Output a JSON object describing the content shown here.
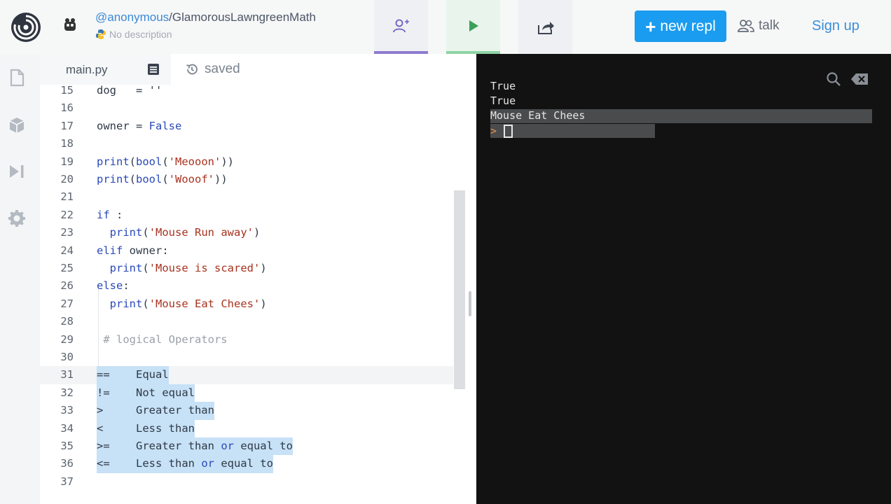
{
  "header": {
    "owner": "@anonymous",
    "separator": "/",
    "repl_name": "GlamorousLawngreenMath",
    "description": "No description",
    "new_repl_label": "new repl",
    "talk_label": "talk",
    "signup_label": "Sign up",
    "icons": [
      "logo-icon",
      "avatar-icon",
      "python-icon",
      "invite-user-icon",
      "run-icon",
      "share-icon",
      "talk-icon"
    ]
  },
  "sidebar": {
    "icons": [
      "files-icon",
      "packages-icon",
      "debugger-icon",
      "settings-icon"
    ]
  },
  "editor": {
    "tab_name": "main.py",
    "status": "saved",
    "current_line": "31",
    "lines": [
      {
        "n": "15",
        "text": "dog   = ''"
      },
      {
        "n": "16",
        "text": ""
      },
      {
        "n": "17",
        "text": "owner = False"
      },
      {
        "n": "18",
        "text": ""
      },
      {
        "n": "19",
        "text": "print(bool('Meooon'))"
      },
      {
        "n": "20",
        "text": "print(bool('Wooof'))"
      },
      {
        "n": "21",
        "text": ""
      },
      {
        "n": "22",
        "text": "if :"
      },
      {
        "n": "23",
        "text": "  print('Mouse Run away')"
      },
      {
        "n": "24",
        "text": "elif owner:"
      },
      {
        "n": "25",
        "text": "  print('Mouse is scared')"
      },
      {
        "n": "26",
        "text": "else:"
      },
      {
        "n": "27",
        "text": "  print('Mouse Eat Chees')"
      },
      {
        "n": "28",
        "text": ""
      },
      {
        "n": "29",
        "text": " # logical Operators"
      },
      {
        "n": "30",
        "text": ""
      },
      {
        "n": "31",
        "text": "==    Equal"
      },
      {
        "n": "32",
        "text": "!=    Not equal"
      },
      {
        "n": "33",
        "text": ">     Greater than"
      },
      {
        "n": "34",
        "text": "<     Less than"
      },
      {
        "n": "35",
        "text": ">=    Greater than or equal to"
      },
      {
        "n": "36",
        "text": "<=    Less than or equal to"
      },
      {
        "n": "37",
        "text": ""
      }
    ]
  },
  "console": {
    "output": [
      "True",
      "True",
      "Mouse Eat Chees"
    ],
    "prompt": ">",
    "icons": [
      "search-icon",
      "clear-console-icon"
    ]
  }
}
